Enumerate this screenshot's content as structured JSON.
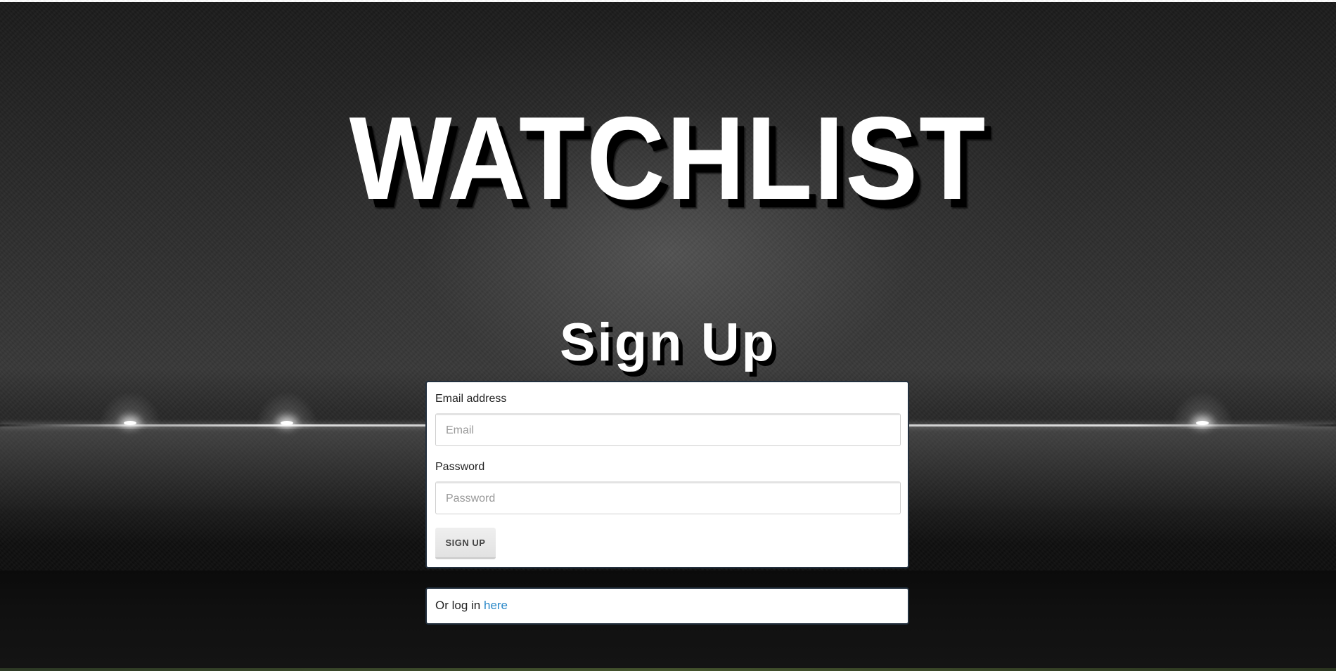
{
  "app": {
    "title": "WATCHLIST",
    "page_heading": "Sign Up"
  },
  "signup_form": {
    "email": {
      "label": "Email address",
      "placeholder": "Email",
      "value": ""
    },
    "password": {
      "label": "Password",
      "placeholder": "Password",
      "value": ""
    },
    "submit_label": "SIGN UP"
  },
  "login_prompt": {
    "text": "Or log in",
    "link_text": "here"
  },
  "colors": {
    "card_border": "#23303e",
    "link": "#2a88c8",
    "button_bg": "#e6e6e6",
    "title_text": "#ffffff"
  }
}
